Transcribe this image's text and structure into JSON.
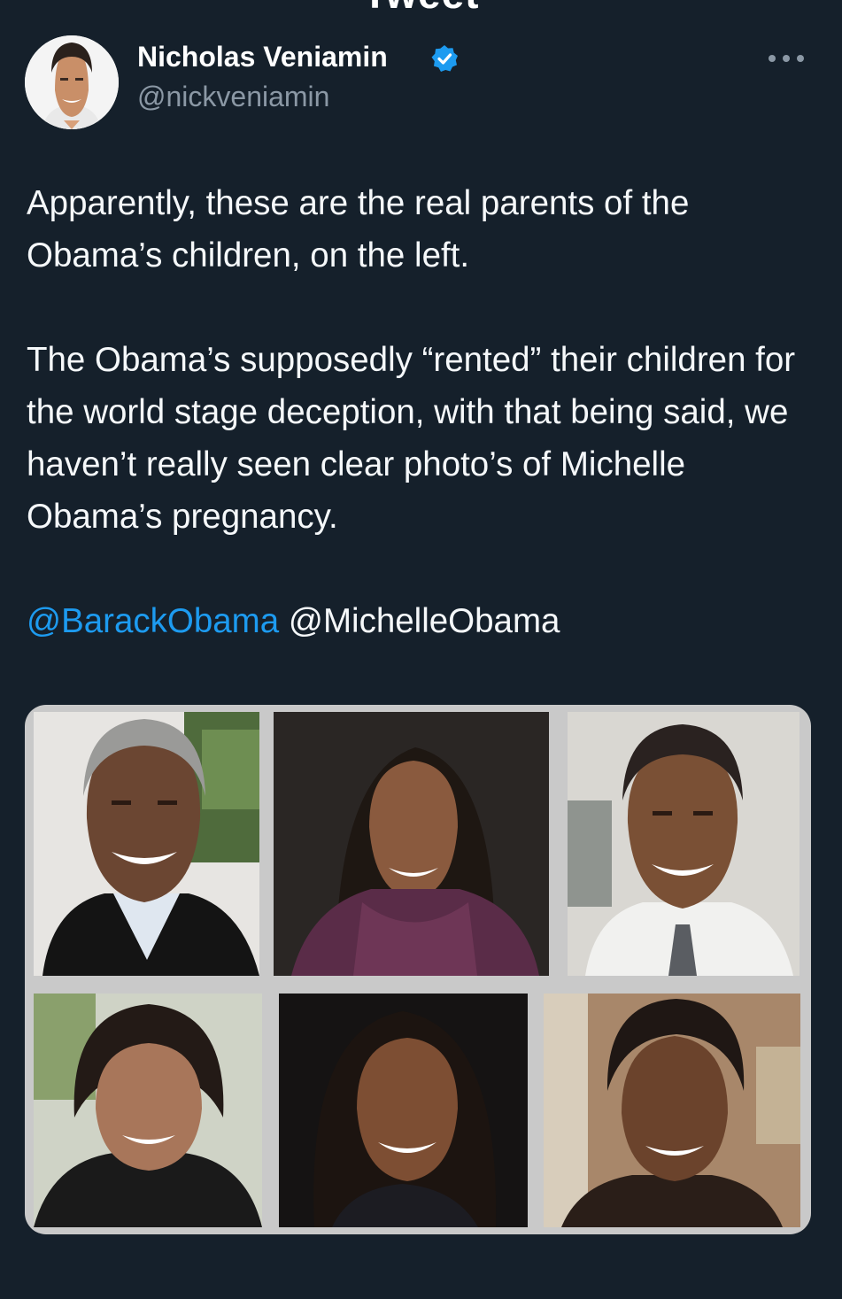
{
  "header": {
    "title": "Tweet",
    "back_icon": "back-arrow-icon"
  },
  "tweet": {
    "author": {
      "display_name": "Nicholas Veniamin",
      "handle": "@nickveniamin",
      "verified": true,
      "verified_color": "#1d9bf0"
    },
    "more_icon": "more-horizontal-icon",
    "paragraphs": [
      "Apparently, these are the real parents of the Obama’s children, on the left.",
      "The Obama’s supposedly “rented” their children for the world stage deception, with that being said, we haven’t really seen clear photo’s of Michelle Obama’s pregnancy."
    ],
    "mentions": [
      {
        "text": "@BarackObama",
        "linked": true
      },
      {
        "text": "@MichelleObama",
        "linked": false
      }
    ]
  },
  "colors": {
    "background": "#15202b",
    "link": "#1d9bf0",
    "secondary_text": "#8b98a5"
  }
}
